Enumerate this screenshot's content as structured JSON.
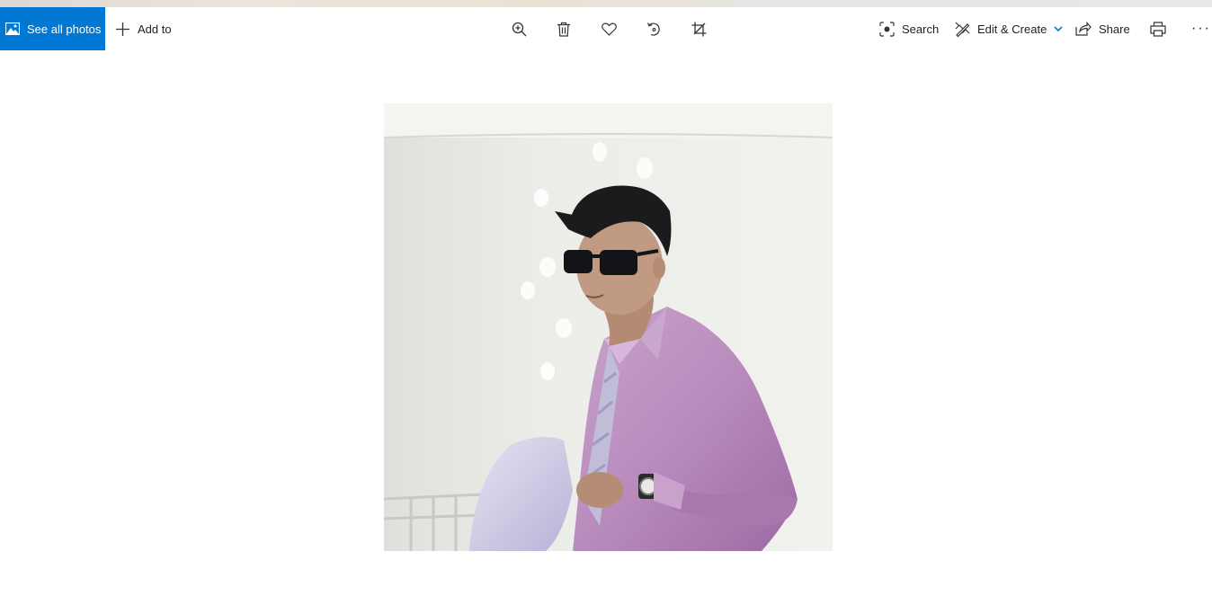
{
  "toolbar": {
    "see_all_photos": "See all photos",
    "add_to": "Add to",
    "search": "Search",
    "edit_create": "Edit & Create",
    "share": "Share",
    "more": "···"
  },
  "icons": {
    "see_all": "photos-icon",
    "add": "plus-icon",
    "zoom": "zoom-in-icon",
    "delete": "trash-icon",
    "favorite": "heart-icon",
    "rotate": "rotate-icon",
    "crop": "crop-icon",
    "search": "visual-search-icon",
    "edit": "edit-create-icon",
    "chevron": "chevron-down-icon",
    "share": "share-icon",
    "print": "print-icon"
  },
  "colors": {
    "accent": "#0078d4",
    "chevron": "#0078d4"
  },
  "photo": {
    "subject": "man-in-pink-shirt-and-sunglasses"
  }
}
